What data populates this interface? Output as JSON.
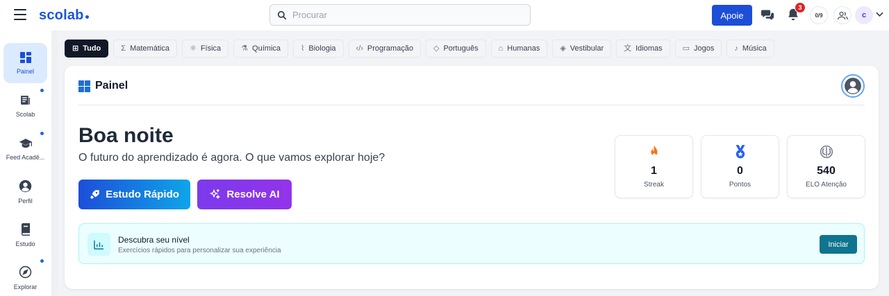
{
  "app": {
    "logo": "scolab"
  },
  "header": {
    "search_placeholder": "Procurar",
    "apoie_label": "Apoie",
    "notification_count": "3",
    "counter_label": "0/9",
    "avatar_initial": "c"
  },
  "sidebar": {
    "items": [
      {
        "label": "Painel",
        "icon": "dashboard-icon",
        "active": true
      },
      {
        "label": "Scolab",
        "icon": "newspaper-icon"
      },
      {
        "label": "Feed Acadê...",
        "icon": "graduation-cap-icon"
      },
      {
        "label": "Perfil",
        "icon": "user-circle-icon"
      },
      {
        "label": "Estudo",
        "icon": "book-icon"
      },
      {
        "label": "Explorar",
        "icon": "compass-icon"
      }
    ]
  },
  "categories": [
    {
      "label": "Tudo",
      "icon": "grid-icon",
      "active": true
    },
    {
      "label": "Matemática",
      "icon": "sigma-icon"
    },
    {
      "label": "Física",
      "icon": "atom-icon"
    },
    {
      "label": "Química",
      "icon": "flask-icon"
    },
    {
      "label": "Biologia",
      "icon": "dna-icon"
    },
    {
      "label": "Programação",
      "icon": "code-icon"
    },
    {
      "label": "Português",
      "icon": "tag-icon"
    },
    {
      "label": "Humanas",
      "icon": "landmark-icon"
    },
    {
      "label": "Vestibular",
      "icon": "graduation-icon"
    },
    {
      "label": "Idiomas",
      "icon": "languages-icon"
    },
    {
      "label": "Jogos",
      "icon": "gamepad-icon"
    },
    {
      "label": "Música",
      "icon": "music-icon"
    }
  ],
  "panel": {
    "title": "Painel",
    "greeting": "Boa noite",
    "subtitle": "O futuro do aprendizado é agora. O que vamos explorar hoje?",
    "quick_study_label": "Estudo Rápido",
    "resolve_ai_label": "Resolve AI"
  },
  "stats": [
    {
      "value": "1",
      "label": "Streak",
      "icon": "flame-icon",
      "color": "#f97316"
    },
    {
      "value": "0",
      "label": "Pontos",
      "icon": "medal-icon",
      "color": "#2563eb"
    },
    {
      "value": "540",
      "label": "ELO Atenção",
      "icon": "brain-icon",
      "color": "#6b7280"
    }
  ],
  "level": {
    "title": "Descubra seu nível",
    "subtitle": "Exercícios rápidos para personalizar sua experiência",
    "button_label": "Iniciar"
  },
  "colors": {
    "brand": "#1a56db",
    "ai_accent": "#7c3aed",
    "level_accent": "#0e7490",
    "notification": "#dc2626"
  }
}
